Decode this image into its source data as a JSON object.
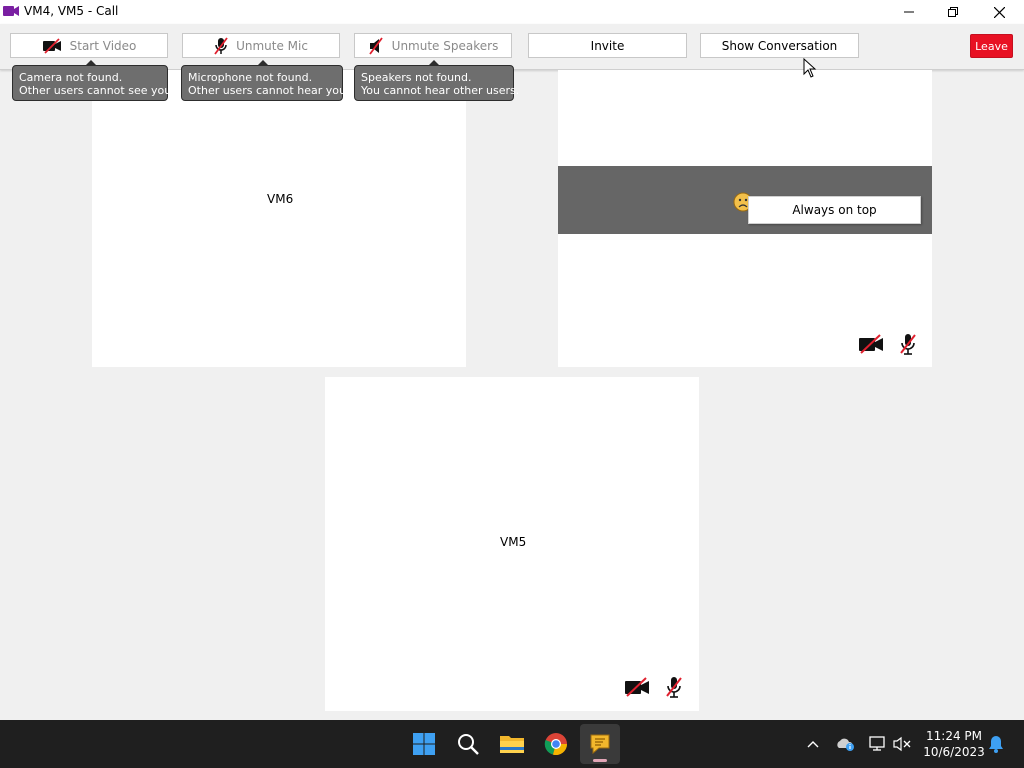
{
  "window": {
    "title": "VM4, VM5 - Call"
  },
  "toolbar": {
    "start_video_label": "Start Video",
    "unmute_mic_label": "Unmute Mic",
    "unmute_speakers_label": "Unmute Speakers",
    "invite_label": "Invite",
    "show_conversation_label": "Show Conversation",
    "leave_label": "Leave"
  },
  "tooltips": {
    "camera_line1": "Camera not found.",
    "camera_line2": "Other users cannot see you.",
    "mic_line1": "Microphone not found.",
    "mic_line2": "Other users cannot hear you.",
    "speakers_line1": "Speakers not found.",
    "speakers_line2": "You cannot hear other users."
  },
  "tiles": {
    "vm6_name": "VM6",
    "vm5_name": "VM5",
    "context_menu_item": "Always on top"
  },
  "taskbar": {
    "time": "11:24 PM",
    "date": "10/6/2023",
    "apps": [
      "start",
      "search",
      "file-explorer",
      "chrome",
      "call-app"
    ]
  },
  "colors": {
    "leave_red": "#e81123",
    "tooltip_bg": "#6e6e6e",
    "band_gray": "#666666",
    "taskbar_bg": "#1f1f1f",
    "mute_slash": "#e0202e"
  }
}
